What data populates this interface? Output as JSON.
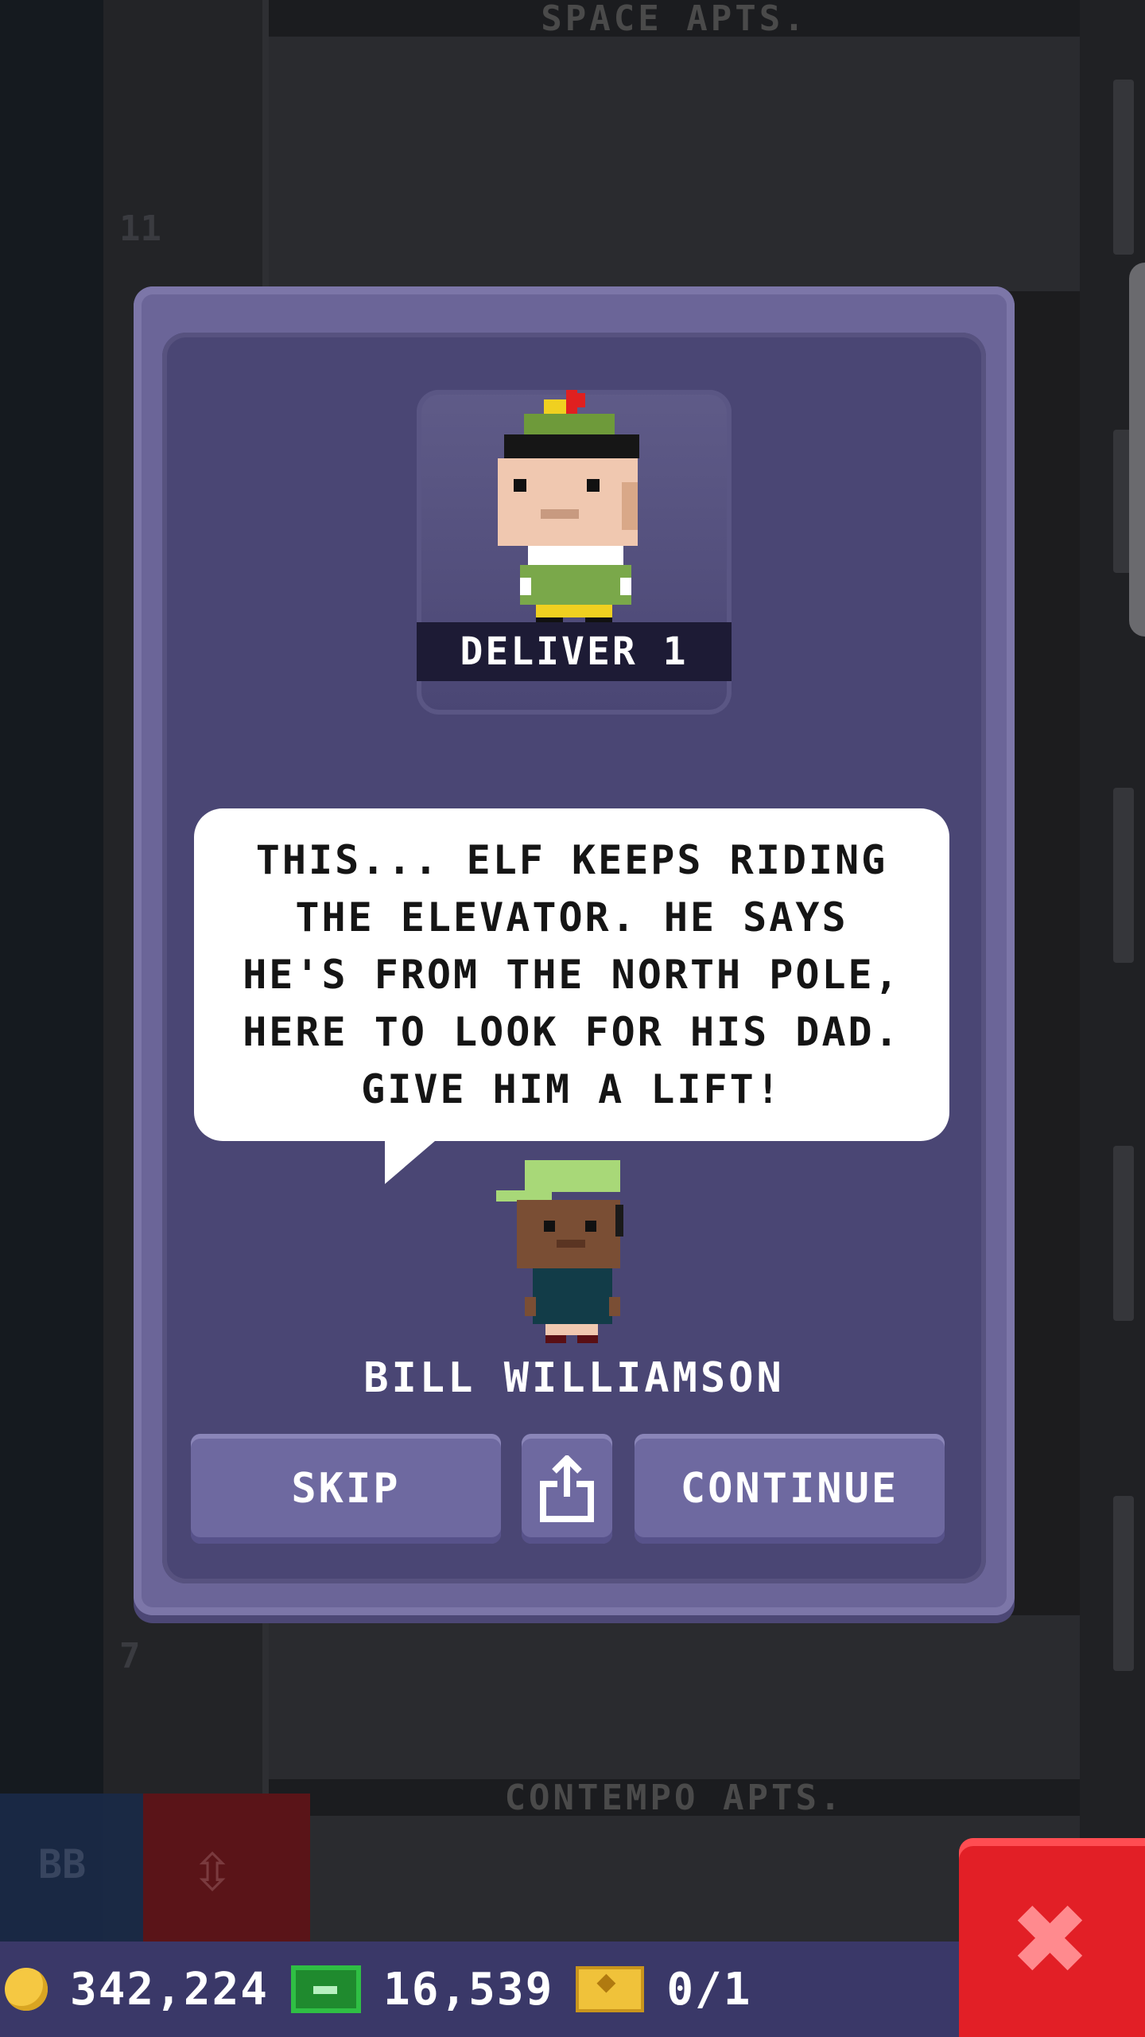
{
  "background": {
    "top_floor_label": "SPACE APTS.",
    "bottom_floor_label": "CONTEMPO APTS.",
    "floor_numbers": [
      "11",
      "7"
    ]
  },
  "modal": {
    "mission_label": "DELIVER 1",
    "speech_lines": [
      "THIS... ELF KEEPS RIDING",
      "THE ELEVATOR. HE SAYS",
      "HE'S FROM THE NORTH POLE,",
      "HERE TO LOOK FOR HIS DAD.",
      "GIVE HIM A LIFT!"
    ],
    "speaker_name": "BILL WILLIAMSON",
    "buttons": {
      "skip": "SKIP",
      "continue": "CONTINUE",
      "share_icon": "share-icon"
    }
  },
  "hud": {
    "coins": "342,224",
    "bux": "16,539",
    "tickets": "0/1",
    "elevator_button_label": "BB"
  },
  "colors": {
    "modal": "#6b6598",
    "modal_inner": "#4a4674",
    "button": "#6e69a0",
    "close": "#e21f26",
    "hud": "#3a3868"
  }
}
